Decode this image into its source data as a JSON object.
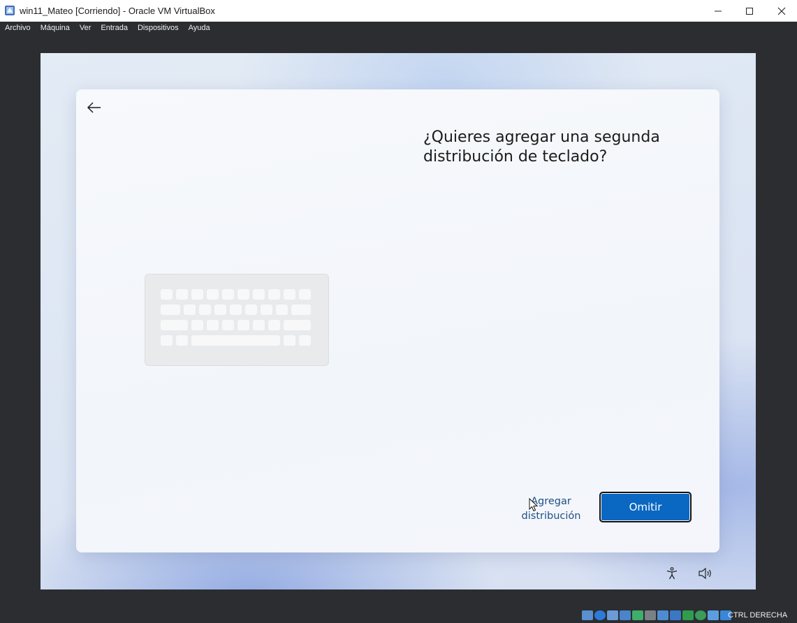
{
  "window": {
    "title": "win11_Mateo [Corriendo] - Oracle VM VirtualBox",
    "controls": [
      "minimize",
      "maximize",
      "close"
    ]
  },
  "menubar": {
    "items": [
      {
        "label": "Archivo"
      },
      {
        "label": "Máquina"
      },
      {
        "label": "Ver"
      },
      {
        "label": "Entrada"
      },
      {
        "label": "Dispositivos"
      },
      {
        "label": "Ayuda"
      }
    ]
  },
  "oobe": {
    "heading": "¿Quieres agregar una segunda distribución de teclado?",
    "secondary_action": "Agregar distribución",
    "primary_action": "Omitir",
    "back_icon": "back-arrow-icon",
    "illustration": "keyboard-illustration"
  },
  "vm_footer": {
    "icons": [
      "accessibility-icon",
      "volume-icon"
    ]
  },
  "statusbar": {
    "host_key": "CTRL DERECHA",
    "icons": [
      "hard-disk-icon",
      "optical-drive-icon",
      "audio-icon",
      "network-icon",
      "usb-icon",
      "shared-folders-icon",
      "display-icon",
      "video-capture-icon",
      "recording-icon",
      "cpu-icon",
      "mouse-integration-icon",
      "keyboard-capture-icon"
    ]
  },
  "colors": {
    "primary_button": "#0a67c2",
    "link_text": "#1e4f86",
    "host_background": "#2b2d30"
  }
}
